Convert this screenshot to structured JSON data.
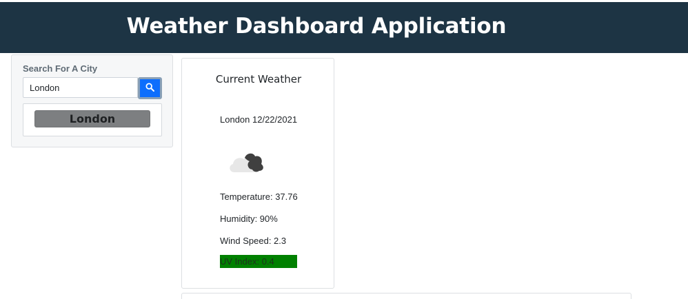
{
  "header": {
    "title": "Weather Dashboard Application"
  },
  "search": {
    "label": "Search For A City",
    "input_value": "London",
    "button_icon": "search-icon",
    "history": [
      "London"
    ]
  },
  "current_weather": {
    "title": "Current Weather",
    "city_date": "London 12/22/2021",
    "icon": "cloudy-icon",
    "temperature": "Temperature: 37.76",
    "humidity": "Humidity: 90%",
    "wind_speed": "Wind Speed: 2.3",
    "uv_index": "UV Index: 0.4",
    "uv_color": "#008000"
  },
  "colors": {
    "header_bg": "#1d3444",
    "search_button": "#0d6efd",
    "history_button": "#7d7f81"
  }
}
